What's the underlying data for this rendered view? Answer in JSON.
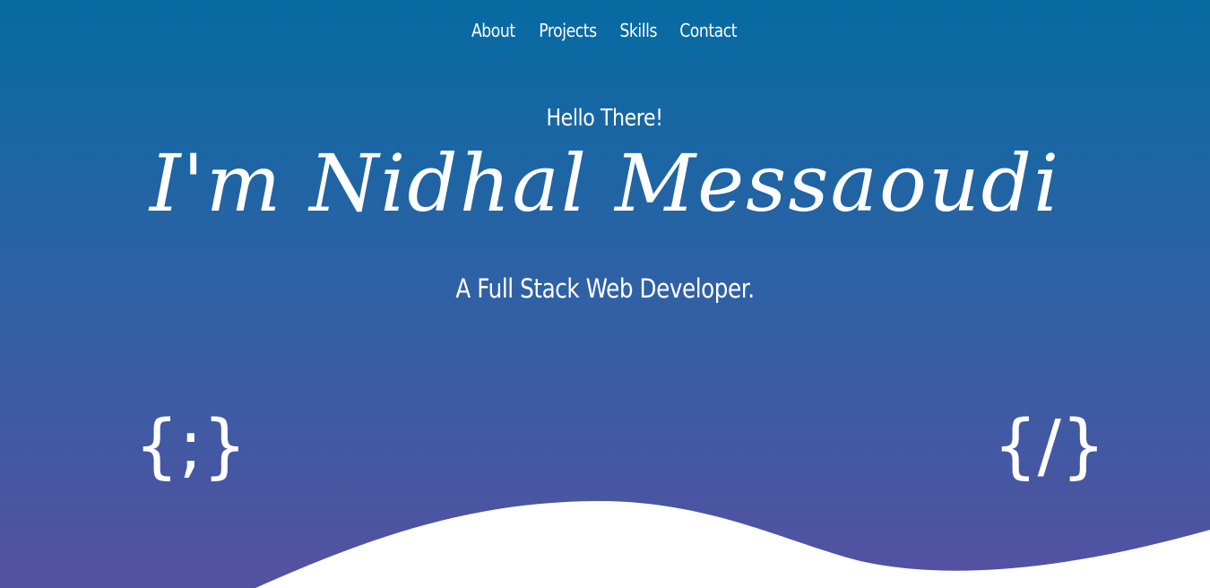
{
  "nav": {
    "items": [
      {
        "label": "About"
      },
      {
        "label": "Projects"
      },
      {
        "label": "Skills"
      },
      {
        "label": "Contact"
      }
    ]
  },
  "hero": {
    "greeting": "Hello There!",
    "name": "I'm Nidhal Messaoudi",
    "tagline": "A Full Stack Web Developer."
  },
  "decorations": {
    "left_icon": "{;}",
    "left_icon_name": "code-semicolon-icon",
    "right_icon": "{/}",
    "right_icon_name": "code-slash-icon"
  },
  "colors": {
    "gradient_top": "#066ba2",
    "gradient_bottom": "#5451a1",
    "text": "#ffffff",
    "wave": "#ffffff"
  }
}
